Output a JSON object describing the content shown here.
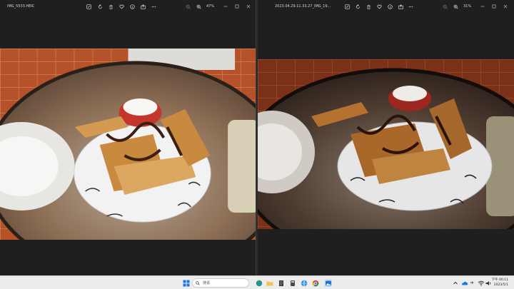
{
  "left_window": {
    "filename": "IMG_5533.HEIC",
    "zoom": "47%",
    "toolbar": [
      "edit-icon",
      "rotate-icon",
      "delete-icon",
      "heart-icon",
      "info-icon",
      "share-icon",
      "more-icon"
    ]
  },
  "right_window": {
    "filename": "2023.04.29.11.33.27_IMG_19...",
    "zoom": "31%",
    "toolbar": [
      "edit-icon",
      "rotate-icon",
      "delete-icon",
      "heart-icon",
      "info-icon",
      "share-icon",
      "more-icon"
    ]
  },
  "taskbar": {
    "search_placeholder": "搜尋",
    "ime": "中",
    "clock_time": "下午 00:11",
    "clock_date": "2023/5/1",
    "colors": {
      "background": "#ececec",
      "start": "#1e78d7"
    }
  }
}
